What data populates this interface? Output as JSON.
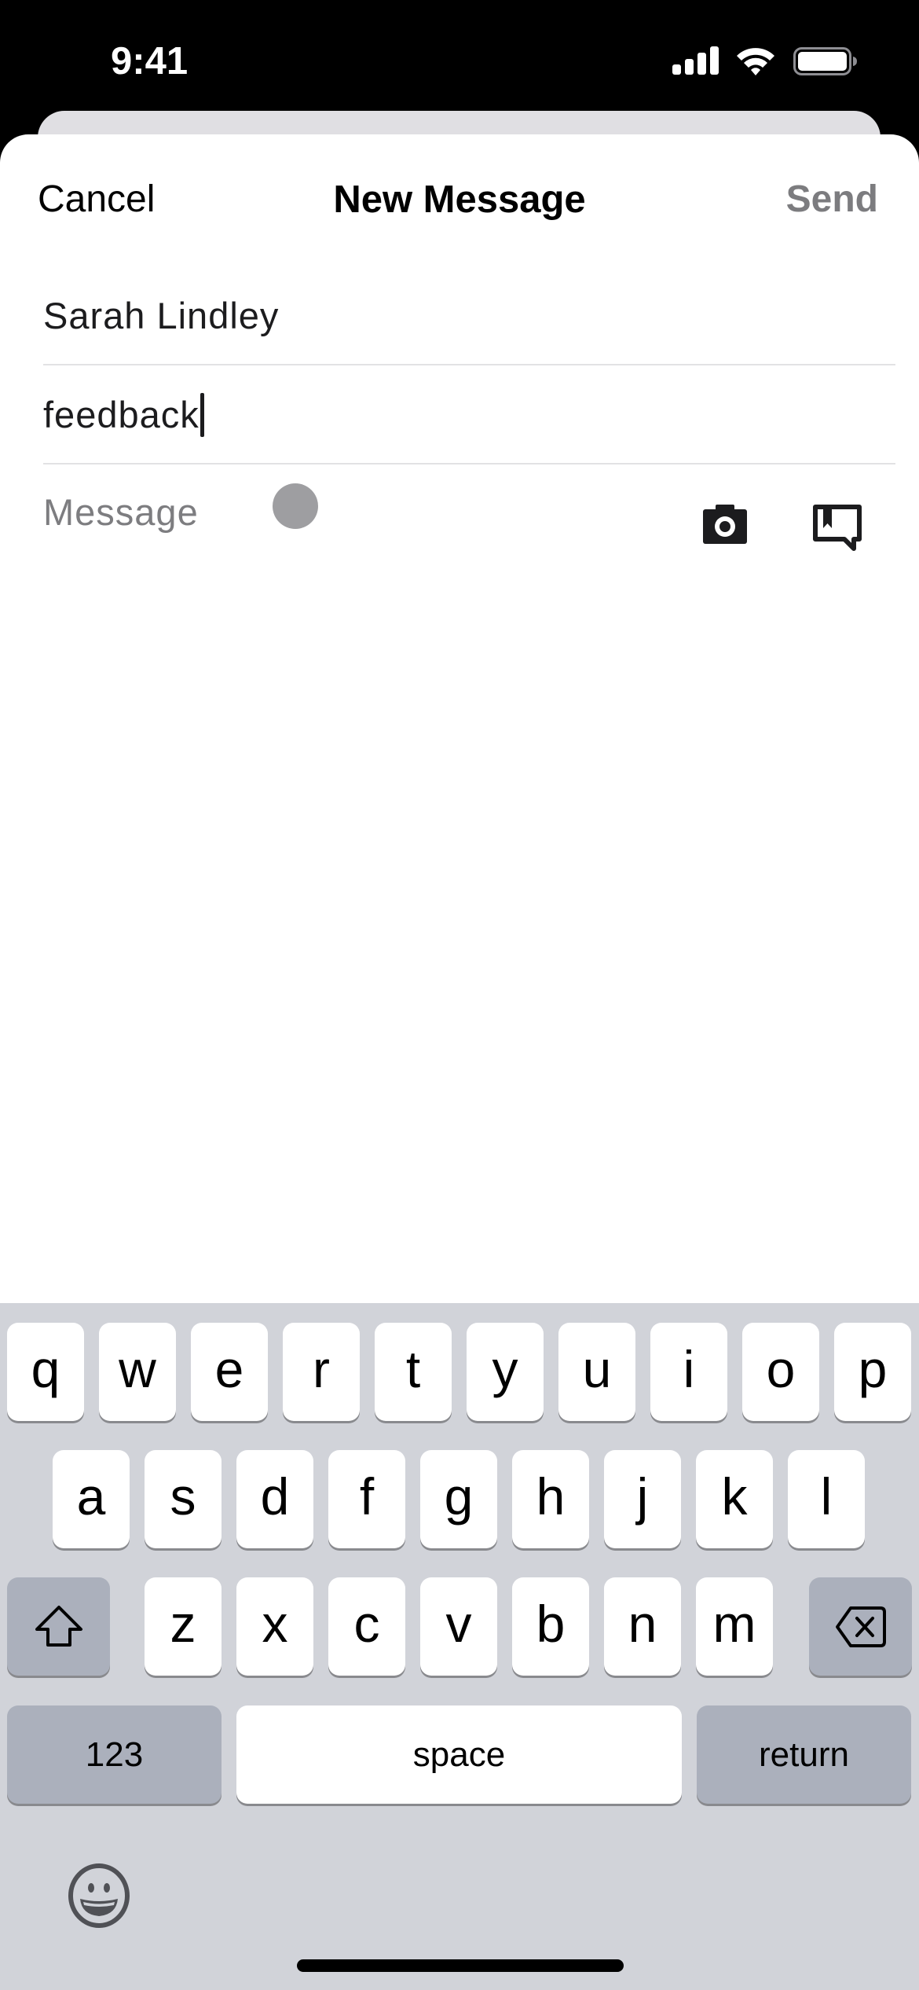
{
  "status_bar": {
    "time": "9:41",
    "icons": [
      "cellular-signal-icon",
      "wifi-icon",
      "battery-icon"
    ]
  },
  "nav": {
    "cancel_label": "Cancel",
    "title": "New Message",
    "send_label": "Send",
    "send_color": "#7c7c7f"
  },
  "compose": {
    "to_value": "Sarah Lindley",
    "subject_value": "feedback",
    "message_placeholder": "Message",
    "icons": [
      "camera-icon",
      "feedback-bookmark-icon"
    ]
  },
  "keyboard": {
    "row1": [
      "q",
      "w",
      "e",
      "r",
      "t",
      "y",
      "u",
      "i",
      "o",
      "p"
    ],
    "row2": [
      "a",
      "s",
      "d",
      "f",
      "g",
      "h",
      "j",
      "k",
      "l"
    ],
    "row3": [
      "z",
      "x",
      "c",
      "v",
      "b",
      "n",
      "m"
    ],
    "shift_icon": "shift-icon",
    "delete_icon": "delete-icon",
    "numbers_label": "123",
    "space_label": "space",
    "return_label": "return",
    "emoji_icon": "emoji-icon"
  }
}
